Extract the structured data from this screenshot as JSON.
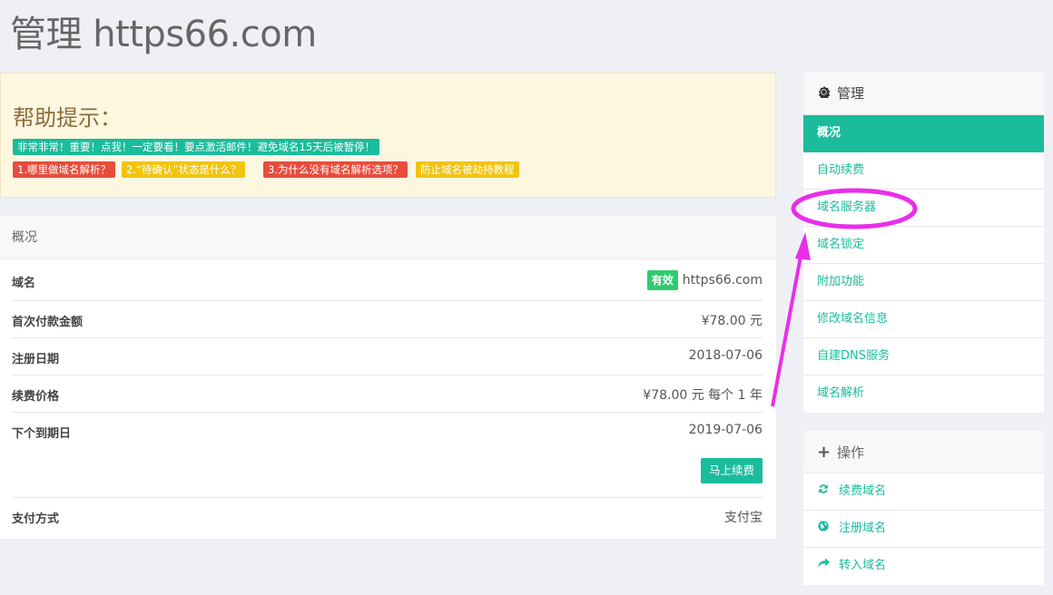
{
  "page": {
    "title": "管理 https66.com"
  },
  "help": {
    "title": "帮助提示：",
    "notice": "非常非常！重要！点我！一定要看！要点激活邮件！避免域名15天后被暂停！",
    "links": [
      "1.哪里做域名解析？",
      "2.“待确认”状态是什么？",
      "3.为什么没有域名解析选项？",
      "防止域名被劫持教程"
    ]
  },
  "overview": {
    "title": "概况",
    "rows": [
      {
        "label": "域名",
        "badge": "有效",
        "value": "https66.com"
      },
      {
        "label": "首次付款金额",
        "value": "¥78.00 元"
      },
      {
        "label": "注册日期",
        "value": "2018-07-06"
      },
      {
        "label": "续费价格",
        "value": "¥78.00 元 每个 1 年"
      },
      {
        "label": "下个到期日",
        "value": "2019-07-06"
      },
      {
        "label": "支付方式",
        "value": "支付宝"
      }
    ],
    "renew_button": "马上续费"
  },
  "manage_panel": {
    "title": "管理",
    "icon": "gear-icon",
    "items": [
      "概况",
      "自动续费",
      "域名服务器",
      "域名锁定",
      "附加功能",
      "修改域名信息",
      "自建DNS服务",
      "域名解析"
    ]
  },
  "ops_panel": {
    "title": "操作",
    "icon": "plus-icon",
    "items": [
      {
        "label": "续费域名",
        "icon": "refresh-icon"
      },
      {
        "label": "注册域名",
        "icon": "globe-icon"
      },
      {
        "label": "转入域名",
        "icon": "share-icon"
      }
    ]
  },
  "colors": {
    "accent": "#1abc9c",
    "annotation": "#e92ee9",
    "help_bg": "#fdf7e0",
    "valid_badge": "#2ecc71"
  }
}
